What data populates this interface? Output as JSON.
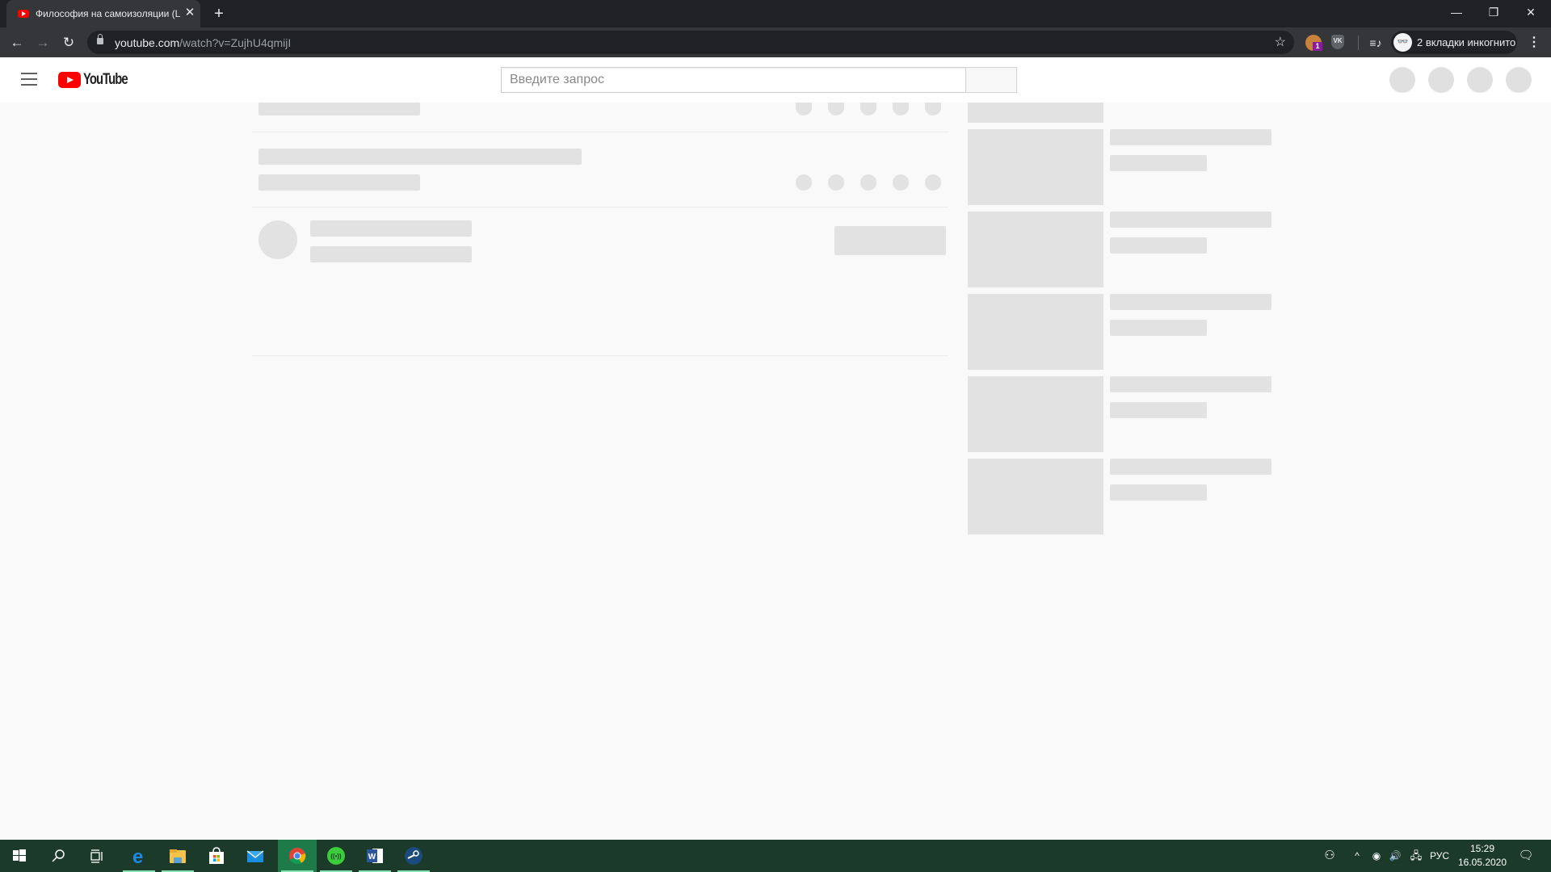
{
  "browser": {
    "tab": {
      "title": "Философия на самоизоляции (L",
      "favicon": "youtube-icon",
      "close_label": "✕"
    },
    "new_tab_label": "+",
    "window_controls": {
      "minimize": "—",
      "restore": "❐",
      "close": "✕"
    },
    "nav": {
      "back": "←",
      "forward": "→",
      "reload": "↻"
    },
    "address": {
      "host": "youtube.com",
      "path": "/watch?v=ZujhU4qmijI",
      "star": "☆"
    },
    "extensions": [
      {
        "name": "monkey-extension",
        "badge": "1"
      },
      {
        "name": "vk-extension",
        "label": "VK"
      }
    ],
    "media_label": "≡♪",
    "incognito": {
      "icon": "👓",
      "label": "2 вкладки инкогнито"
    },
    "menu_label": "⋮"
  },
  "youtube": {
    "logo_text": "YouTube",
    "search": {
      "placeholder": "Введите запрос",
      "value": ""
    },
    "accent": "#ff0000"
  },
  "taskbar": {
    "apps": [
      {
        "name": "start",
        "glyph": "⊞"
      },
      {
        "name": "search",
        "glyph": "⚲"
      },
      {
        "name": "task-view",
        "glyph": "⧉"
      },
      {
        "name": "edge",
        "glyph": "e"
      },
      {
        "name": "file-explorer",
        "glyph": "📁"
      },
      {
        "name": "store",
        "glyph": "🛍"
      },
      {
        "name": "mail",
        "glyph": "✉"
      },
      {
        "name": "chrome",
        "glyph": "◉"
      },
      {
        "name": "podcast-app",
        "glyph": "((•))"
      },
      {
        "name": "word",
        "glyph": "W"
      },
      {
        "name": "steam",
        "glyph": "⚙"
      }
    ],
    "tray": {
      "people": "⚇",
      "chevron": "^",
      "discord": "◉",
      "volume": "🔊",
      "network": "🖧",
      "language": "РУС"
    },
    "time": "15:29",
    "date": "16.05.2020",
    "notifications": "🗨"
  }
}
